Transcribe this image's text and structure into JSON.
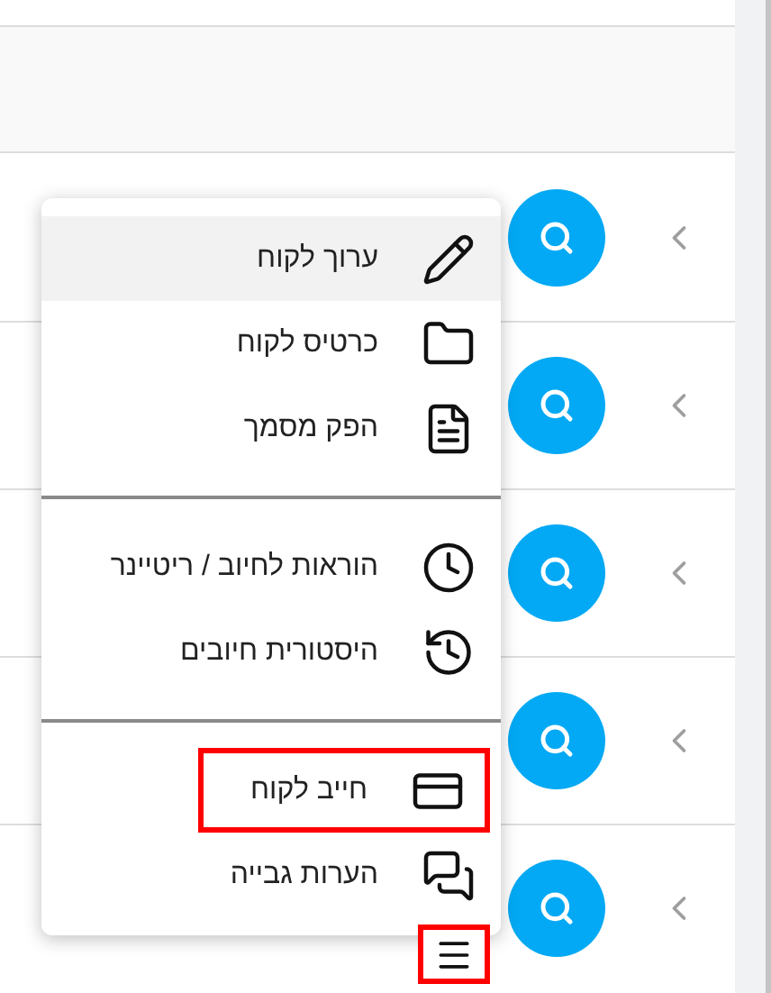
{
  "menu": {
    "groups": [
      [
        {
          "label": "ערוך לקוח",
          "selected": true,
          "highlighted": false
        },
        {
          "label": "כרטיס לקוח",
          "selected": false,
          "highlighted": false
        },
        {
          "label": "הפק מסמך",
          "selected": false,
          "highlighted": false
        }
      ],
      [
        {
          "label": "הוראות לחיוב / ריטיינר",
          "selected": false,
          "highlighted": false
        },
        {
          "label": "היסטורית חיובים",
          "selected": false,
          "highlighted": false
        }
      ],
      [
        {
          "label": "חייב לקוח",
          "selected": false,
          "highlighted": true
        },
        {
          "label": "הערות גבייה",
          "selected": false,
          "highlighted": false
        }
      ]
    ]
  },
  "menu_button": {
    "highlighted": true
  }
}
